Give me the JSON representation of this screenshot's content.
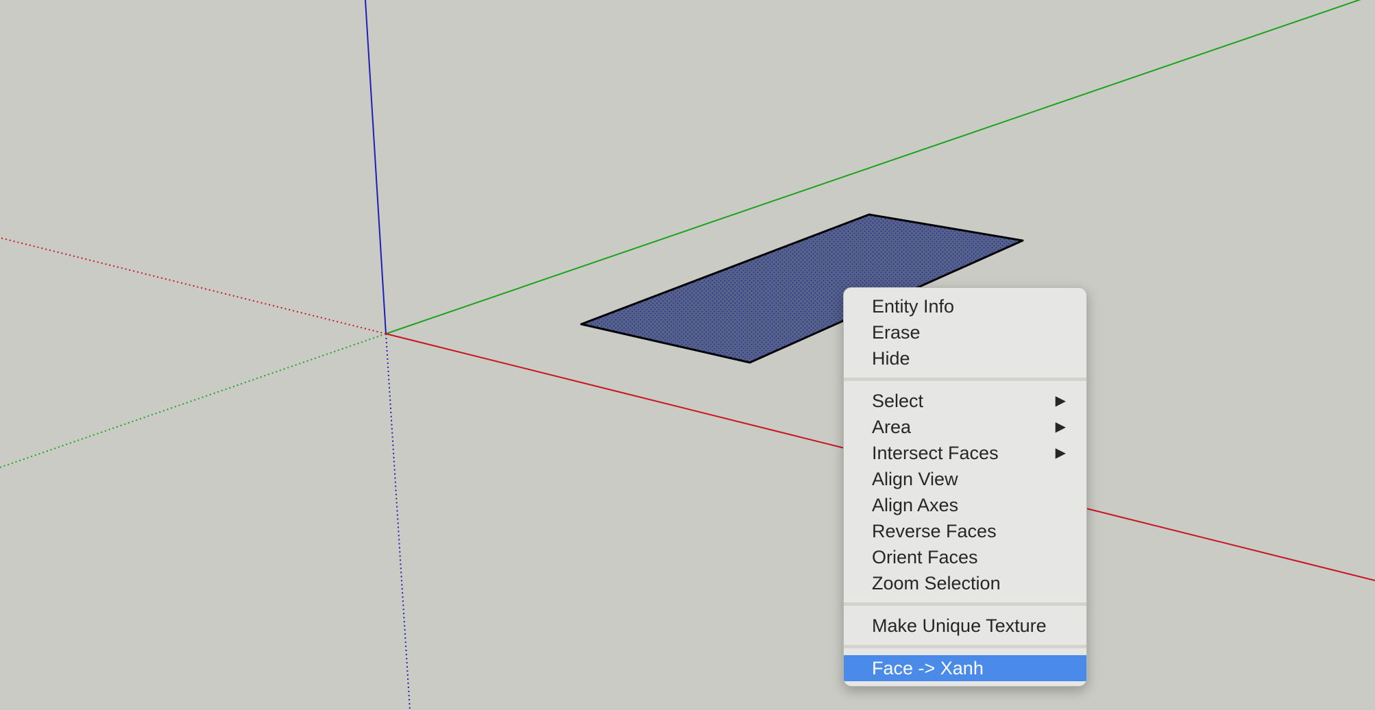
{
  "canvas": {
    "background": "#cbcbc6",
    "axis_colors": {
      "red_axis": "#c8141e",
      "green_axis": "#1aa31a",
      "blue_axis": "#1e1eb4"
    },
    "selected_face": {
      "fill": "#5a6381",
      "stipple": "#1c2fb8",
      "edge": "#000000",
      "state": "selected"
    }
  },
  "context_menu": {
    "highlight_color": "#4a8ae8",
    "groups": [
      [
        {
          "label": "Entity Info"
        },
        {
          "label": "Erase"
        },
        {
          "label": "Hide"
        }
      ],
      [
        {
          "label": "Select",
          "submenu": true,
          "arrow": "▶"
        },
        {
          "label": "Area",
          "submenu": true,
          "arrow": "▶"
        },
        {
          "label": "Intersect Faces",
          "submenu": true,
          "arrow": "▶"
        },
        {
          "label": "Align View"
        },
        {
          "label": "Align Axes"
        },
        {
          "label": "Reverse Faces"
        },
        {
          "label": "Orient Faces"
        },
        {
          "label": "Zoom Selection"
        }
      ],
      [
        {
          "label": "Make Unique Texture"
        }
      ],
      [
        {
          "label": "Face -> Xanh",
          "highlighted": true
        }
      ]
    ]
  }
}
